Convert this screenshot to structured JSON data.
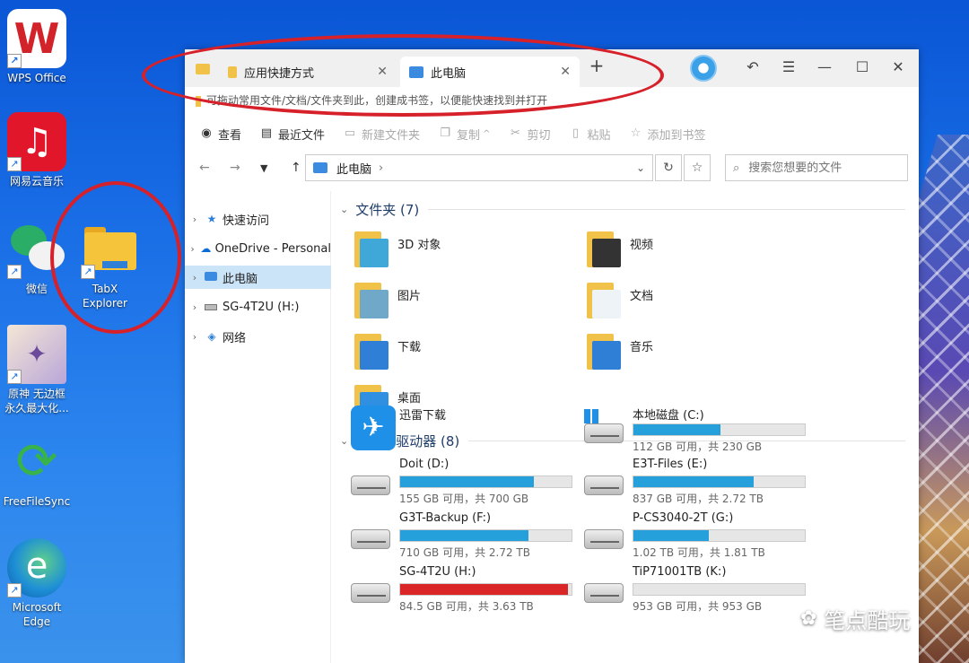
{
  "desktop": {
    "icons": [
      {
        "label": "WPS Office",
        "color": "#d2232a",
        "glyph": "W"
      },
      {
        "label": "网易云音乐",
        "color": "#e2162b",
        "glyph": "♫"
      },
      {
        "label": "微信",
        "color": "#2aae67",
        "glyph": "✉"
      },
      {
        "label": "TabX\nExplorer",
        "color": "#f6c43a",
        "glyph": ""
      },
      {
        "label": "原神 无边框\n永久最大化...",
        "color": "#e8d8c8",
        "glyph": "✦"
      },
      {
        "label": "FreeFileSync",
        "color": "#37b34a",
        "glyph": "⟳"
      },
      {
        "label": "Microsoft\nEdge",
        "color": "#1e8fd6",
        "glyph": "e"
      }
    ],
    "watermark": "笔点酷玩"
  },
  "window": {
    "tabs": [
      {
        "label": "应用快捷方式",
        "active": false
      },
      {
        "label": "此电脑",
        "active": true
      }
    ],
    "new_tab": "+",
    "hint": "可拖动常用文件/文档/文件夹到此，创建成书签，以便能快速找到并打开",
    "toolbar": {
      "view": "查看",
      "recent": "最近文件",
      "new_folder": "新建文件夹",
      "copy": "复制",
      "cut": "剪切",
      "paste": "粘贴",
      "bookmark": "添加到书签"
    },
    "address": {
      "path": "此电脑",
      "sep": "›"
    },
    "search": {
      "placeholder": "搜索您想要的文件"
    },
    "sidebar": [
      {
        "label": "快速访问"
      },
      {
        "label": "OneDrive - Personal"
      },
      {
        "label": "此电脑",
        "selected": true
      },
      {
        "label": "SG-4T2U (H:)"
      },
      {
        "label": "网络"
      }
    ],
    "folders_header": "文件夹 (7)",
    "folders": [
      {
        "name": "3D 对象",
        "accent": "#3fa8d8"
      },
      {
        "name": "视频",
        "accent": "#333333"
      },
      {
        "name": "图片",
        "accent": "#6fa8c8"
      },
      {
        "name": "文档",
        "accent": "#eef3f7"
      },
      {
        "name": "下载",
        "accent": "#2f7fd6"
      },
      {
        "name": "音乐",
        "accent": "#2f7fd6"
      },
      {
        "name": "桌面",
        "accent": "#2f8fe0"
      }
    ],
    "devices_header": "设备和驱动器 (8)",
    "devices": [
      {
        "name": "迅雷下载",
        "kind": "app"
      },
      {
        "name": "本地磁盘 (C:)",
        "free": "112 GB 可用，共 230 GB",
        "used_pct": 51,
        "color": "#26a0da"
      },
      {
        "name": "Doit (D:)",
        "free": "155 GB 可用，共 700 GB",
        "used_pct": 78,
        "color": "#26a0da"
      },
      {
        "name": "E3T-Files (E:)",
        "free": "837 GB 可用，共 2.72 TB",
        "used_pct": 70,
        "color": "#26a0da"
      },
      {
        "name": "G3T-Backup (F:)",
        "free": "710 GB 可用，共 2.72 TB",
        "used_pct": 75,
        "color": "#26a0da"
      },
      {
        "name": "P-CS3040-2T (G:)",
        "free": "1.02 TB 可用，共 1.81 TB",
        "used_pct": 44,
        "color": "#26a0da"
      },
      {
        "name": "SG-4T2U (H:)",
        "free": "84.5 GB 可用，共 3.63 TB",
        "used_pct": 98,
        "color": "#da2626"
      },
      {
        "name": "TiP71001TB (K:)",
        "free": "953 GB 可用，共 953 GB",
        "used_pct": 0,
        "color": "#26a0da"
      }
    ]
  }
}
